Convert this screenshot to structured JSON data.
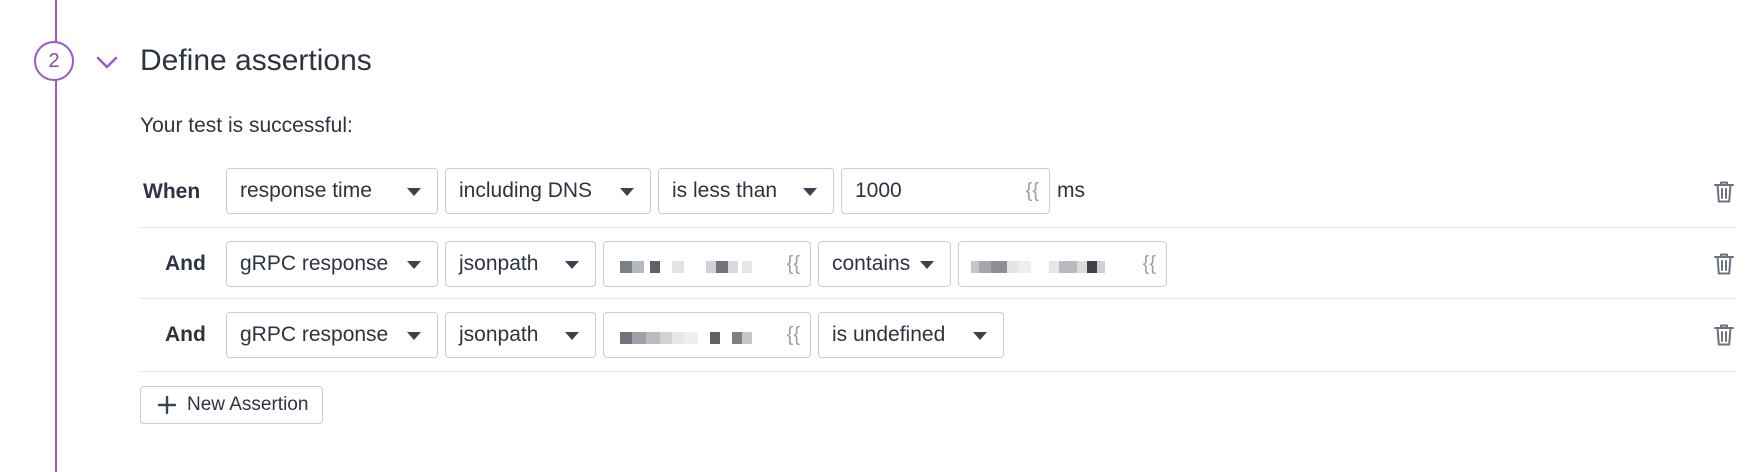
{
  "step": {
    "number": "2",
    "title": "Define assertions"
  },
  "subtitle": "Your test is successful:",
  "icons": {
    "collapse": "chevron-down-icon",
    "delete": "trash-icon",
    "template_variable": "{{",
    "add": "plus-icon"
  },
  "colors": {
    "accent": "#9b59c7",
    "border": "#c9ccd1",
    "text": "#2c3440",
    "muted": "#9aa1ab"
  },
  "assertions": [
    {
      "label": "When",
      "type": "response time",
      "modifier": "including DNS",
      "operator": "is less than",
      "value": "1000",
      "unit": "ms"
    },
    {
      "label": "And",
      "type": "gRPC response",
      "modifier": "jsonpath",
      "operator": "contains"
    },
    {
      "label": "And",
      "type": "gRPC response",
      "modifier": "jsonpath",
      "operator": "is undefined"
    }
  ],
  "new_assertion_label": "New Assertion"
}
